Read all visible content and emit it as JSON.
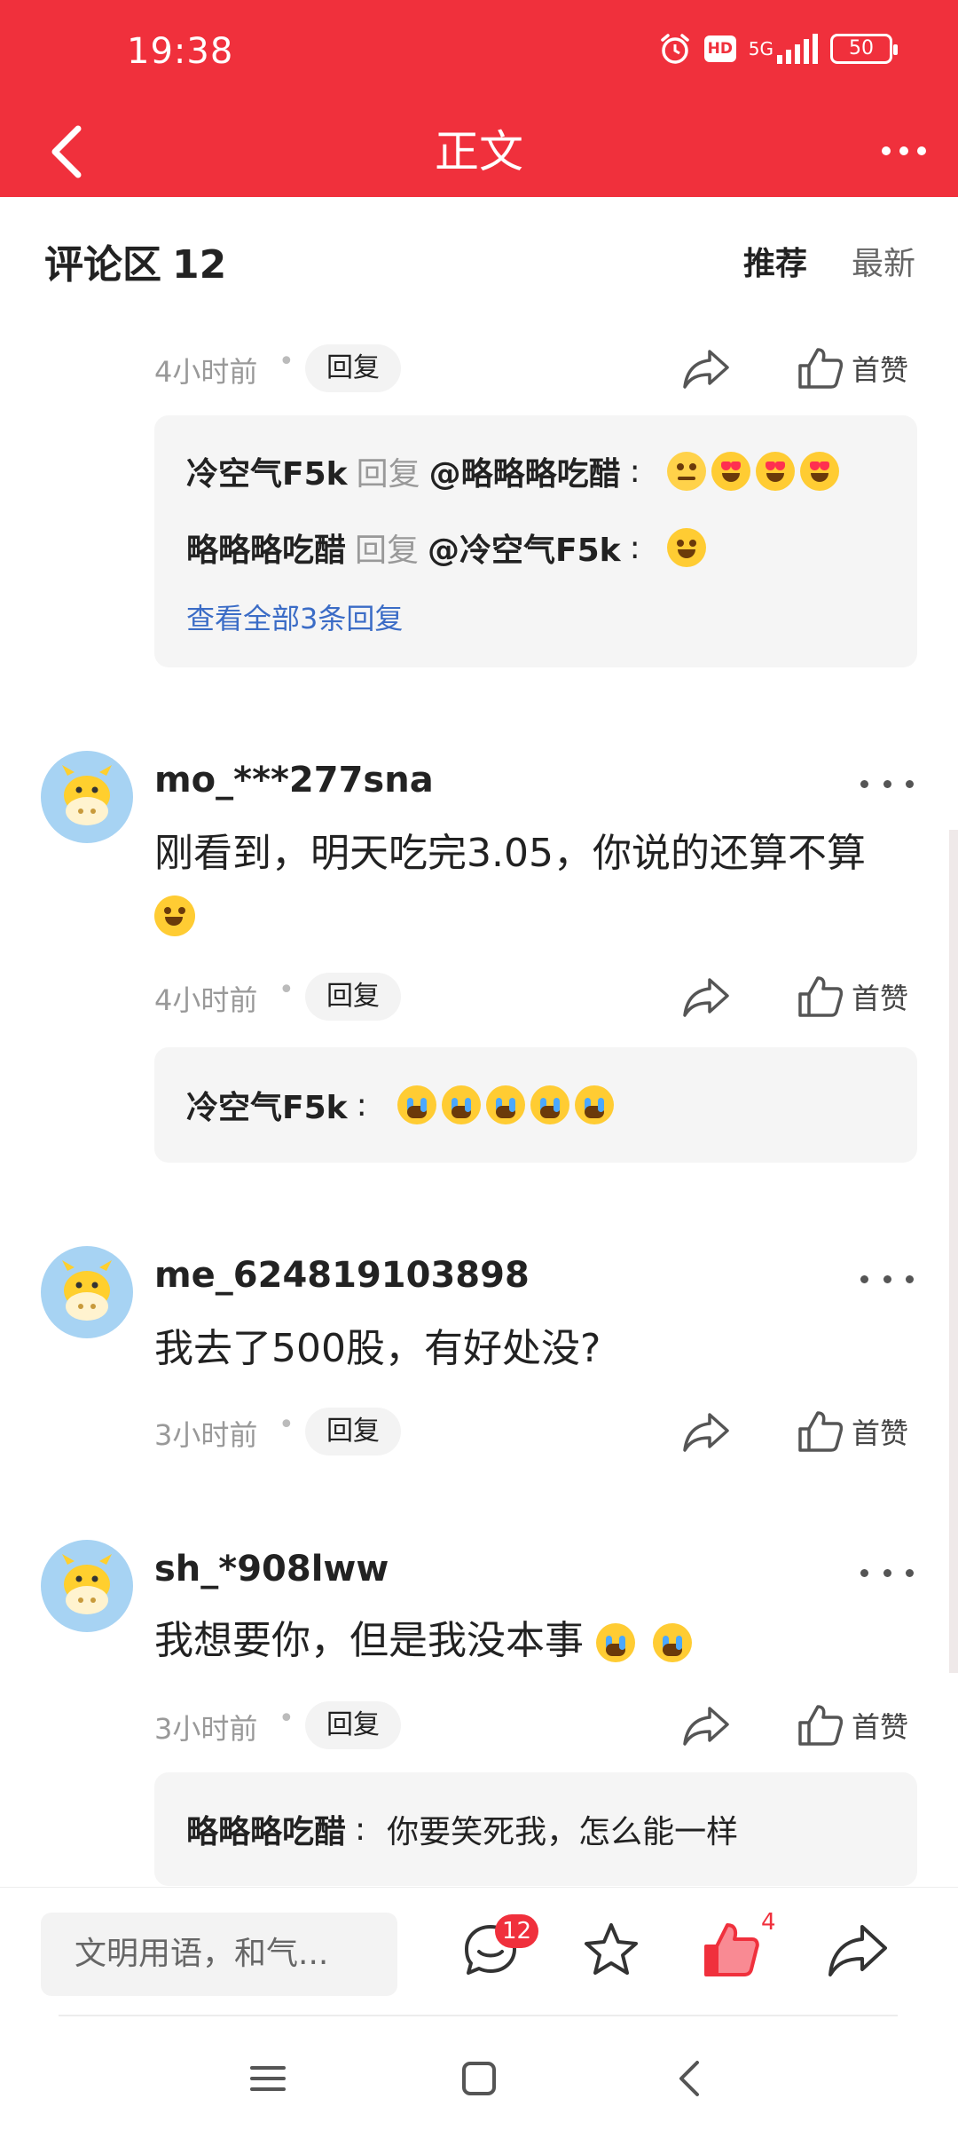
{
  "status_bar": {
    "time": "19:38",
    "network": "5G",
    "hd": "HD",
    "battery": "50"
  },
  "nav": {
    "title": "正文"
  },
  "comments": {
    "title": "评论区",
    "count": "12",
    "sort_recommend": "推荐",
    "sort_latest": "最新"
  },
  "labels": {
    "reply": "回复",
    "like": "首赞",
    "dot": "•"
  },
  "thread0": {
    "time": "4小时前",
    "replies": [
      {
        "user": "冷空气F5k",
        "verb": "回复",
        "mention": "@略略略吃醋",
        "sep": ":"
      },
      {
        "user": "略略略吃醋",
        "verb": "回复",
        "mention": "@冷空气F5k",
        "sep": ":"
      }
    ],
    "view_all": "查看全部3条回复"
  },
  "comment1": {
    "user": "mo_***277sna",
    "text": "刚看到，明天吃完3.05，你说的还算不算",
    "time": "4小时前",
    "reply_user": "冷空气F5k",
    "reply_sep": ":"
  },
  "comment2": {
    "user": "me_624819103898",
    "text": "我去了500股，有好处没?",
    "time": "3小时前"
  },
  "comment3": {
    "user": "sh_*908lww",
    "text": "我想要你，但是我没本事",
    "time": "3小时前",
    "reply_user": "略略略吃醋",
    "reply_sep": ":",
    "reply_text": "你要笑死我，怎么能一样"
  },
  "bottom": {
    "input_placeholder": "文明用语，和气...",
    "comment_badge": "12",
    "like_count": "4"
  },
  "colors": {
    "brand_red": "#f0303c",
    "link_blue": "#3b6cc6"
  },
  "icons": [
    "back-icon",
    "more-icon",
    "share-icon",
    "thumbs-up-icon",
    "comment-icon",
    "star-icon",
    "menu-icon",
    "home-icon"
  ]
}
